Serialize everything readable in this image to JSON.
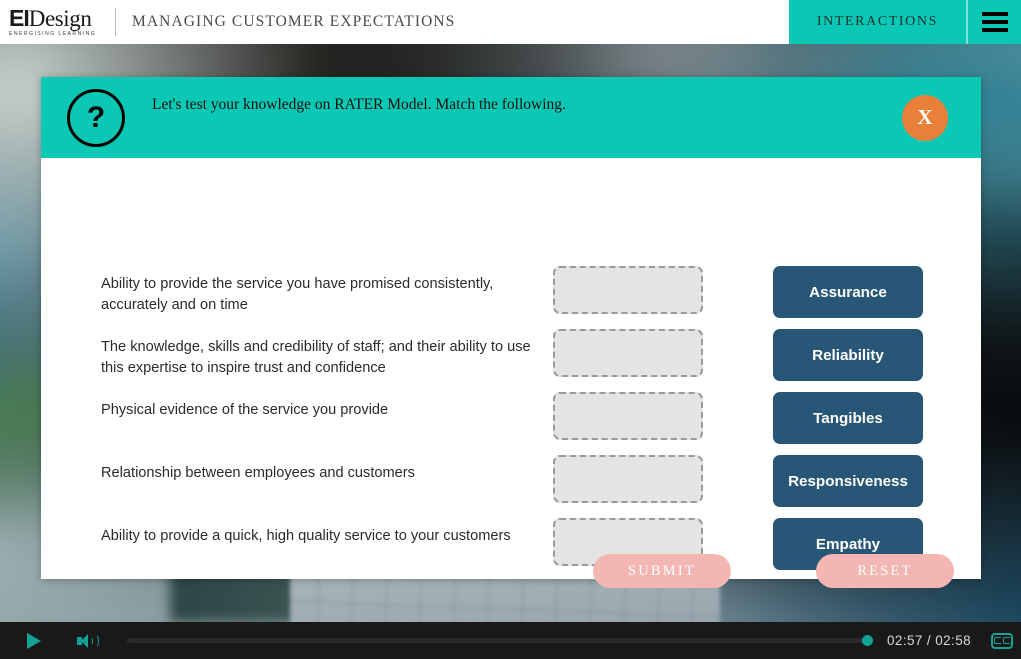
{
  "header": {
    "logo_main": "EIDesign",
    "logo_main_bold": "EI",
    "logo_main_rest": "Design",
    "logo_sub": "ENERGISING LEARNING",
    "course_title": "MANAGING CUSTOMER EXPECTATIONS",
    "tab_interactions": "INTERACTIONS",
    "menu_icon": "hamburger-menu-icon"
  },
  "modal": {
    "help_icon": "?",
    "prompt": "Let's test your knowledge on RATER Model. Match the following.",
    "close_label": "X",
    "close_icon": "close-x-icon",
    "questions": [
      "Ability to provide the service you have promised consistently, accurately and on time",
      "The knowledge, skills and credibility of staff; and their ability to use this expertise to inspire trust and confidence",
      "Physical evidence of the service you provide",
      "Relationship between employees and customers",
      "Ability to provide a quick, high quality service to your customers"
    ],
    "answers": [
      "Assurance",
      "Reliability",
      "Tangibles",
      "Responsiveness",
      "Empathy"
    ],
    "submit_label": "SUBMIT",
    "reset_label": "RESET"
  },
  "player": {
    "play_icon": "play-icon",
    "volume_icon": "volume-icon",
    "time": "02:57 / 02:58",
    "cc_icon": "closed-caption-icon",
    "cc_label": "CC"
  },
  "colors": {
    "teal": "#0bc8b4",
    "navy": "#275676",
    "orange": "#e8803a",
    "pink": "#f3b6b3",
    "player_teal": "#13a396"
  }
}
